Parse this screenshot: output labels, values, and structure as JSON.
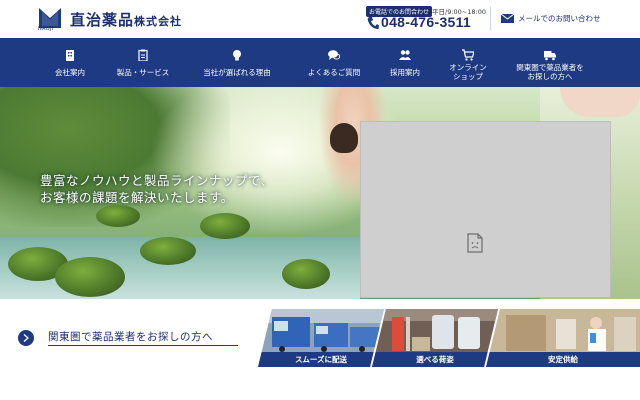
{
  "header": {
    "logo_company": "直治薬品",
    "logo_suffix": "株式会社",
    "logo_sub": "NAOJI",
    "phone_badge": "お電話でのお問合わせ",
    "phone_hours": "平日/9:00~18:00",
    "phone_number": "048-476-3511",
    "mail_label": "メールでのお問い合わせ"
  },
  "nav": {
    "items": [
      {
        "label": "会社案内",
        "icon": "building-icon"
      },
      {
        "label": "製品・サービス",
        "icon": "clipboard-icon"
      },
      {
        "label": "当社が選ばれる理由",
        "icon": "lightbulb-icon"
      },
      {
        "label": "よくあるご質問",
        "icon": "chat-icon"
      },
      {
        "label": "採用案内",
        "icon": "people-icon"
      },
      {
        "label_line1": "オンライン",
        "label_line2": "ショップ",
        "icon": "cart-icon"
      },
      {
        "label_line1": "関東圏で薬品業者を",
        "label_line2": "お探しの方へ",
        "icon": "truck-icon"
      }
    ]
  },
  "hero": {
    "copy_line1": "豊富なノウハウと製品ラインナップで、",
    "copy_line2": "お客様の課題を解決いたします。"
  },
  "banner": {
    "cta_text": "関東圏で薬品業者をお探しの方へ",
    "features": [
      {
        "label": "スムーズに配送"
      },
      {
        "label": "選べる荷姿"
      },
      {
        "label": "安定供給"
      }
    ]
  },
  "colors": {
    "brand_navy": "#1e3a83",
    "text_navy": "#1c2f6b"
  }
}
